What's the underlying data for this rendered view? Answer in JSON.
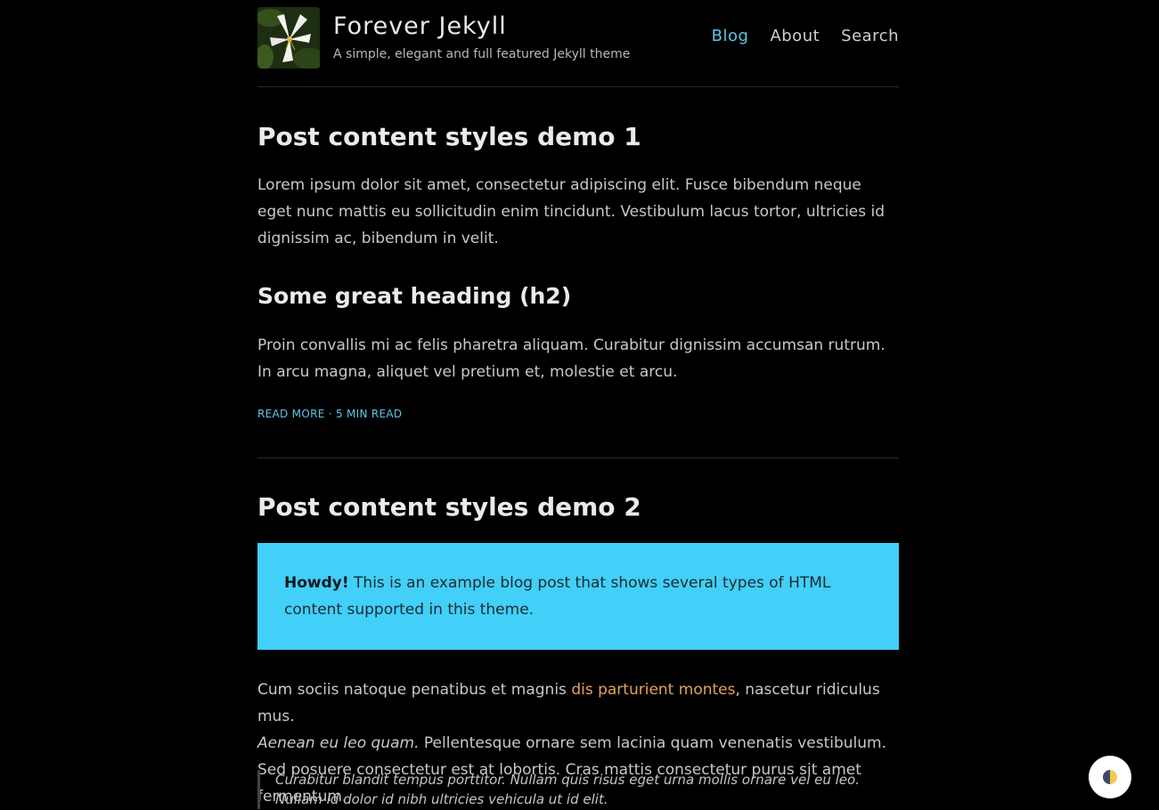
{
  "site": {
    "title": "Forever Jekyll",
    "description": "A simple, elegant and full featured Jekyll theme"
  },
  "nav": [
    {
      "label": "Blog",
      "active": true
    },
    {
      "label": "About",
      "active": false
    },
    {
      "label": "Search",
      "active": false
    }
  ],
  "post1": {
    "title": "Post content styles demo 1",
    "para1": "Lorem ipsum dolor sit amet, consectetur adipiscing elit. Fusce bibendum neque eget nunc mattis eu sollicitudin enim tincidunt. Vestibulum lacus tortor, ultricies id dignissim ac, bibendum in velit.",
    "heading": "Some great heading (h2)",
    "para2": "Proin convallis mi ac felis pharetra aliquam. Curabitur dignissim accumsan rutrum. In arcu magna, aliquet vel pretium et, molestie et arcu.",
    "read_more": "READ MORE · 5 MIN READ"
  },
  "post2": {
    "title": "Post content styles demo 2",
    "notice_bold": "Howdy!",
    "notice_text": " This is an example blog post that shows several types of HTML content supported in this theme.",
    "para_start": "Cum sociis natoque penatibus et magnis ",
    "para_link": "dis parturient montes",
    "para_mid": ", nascetur ridiculus mus.",
    "para_em": "Aenean eu leo quam.",
    "para_end": " Pellentesque ornare sem lacinia quam venenatis vestibulum. Sed posuere consectetur est at lobortis. Cras mattis consectetur purus sit amet fermentum.",
    "quote": "Curabitur blandit tempus porttitor. Nullam quis risus eget urna mollis ornare vel eu leo. Nullam id dolor id nibh ultricies vehicula ut id elit."
  },
  "theme_toggle": {
    "icon": "half-circle-icon"
  }
}
